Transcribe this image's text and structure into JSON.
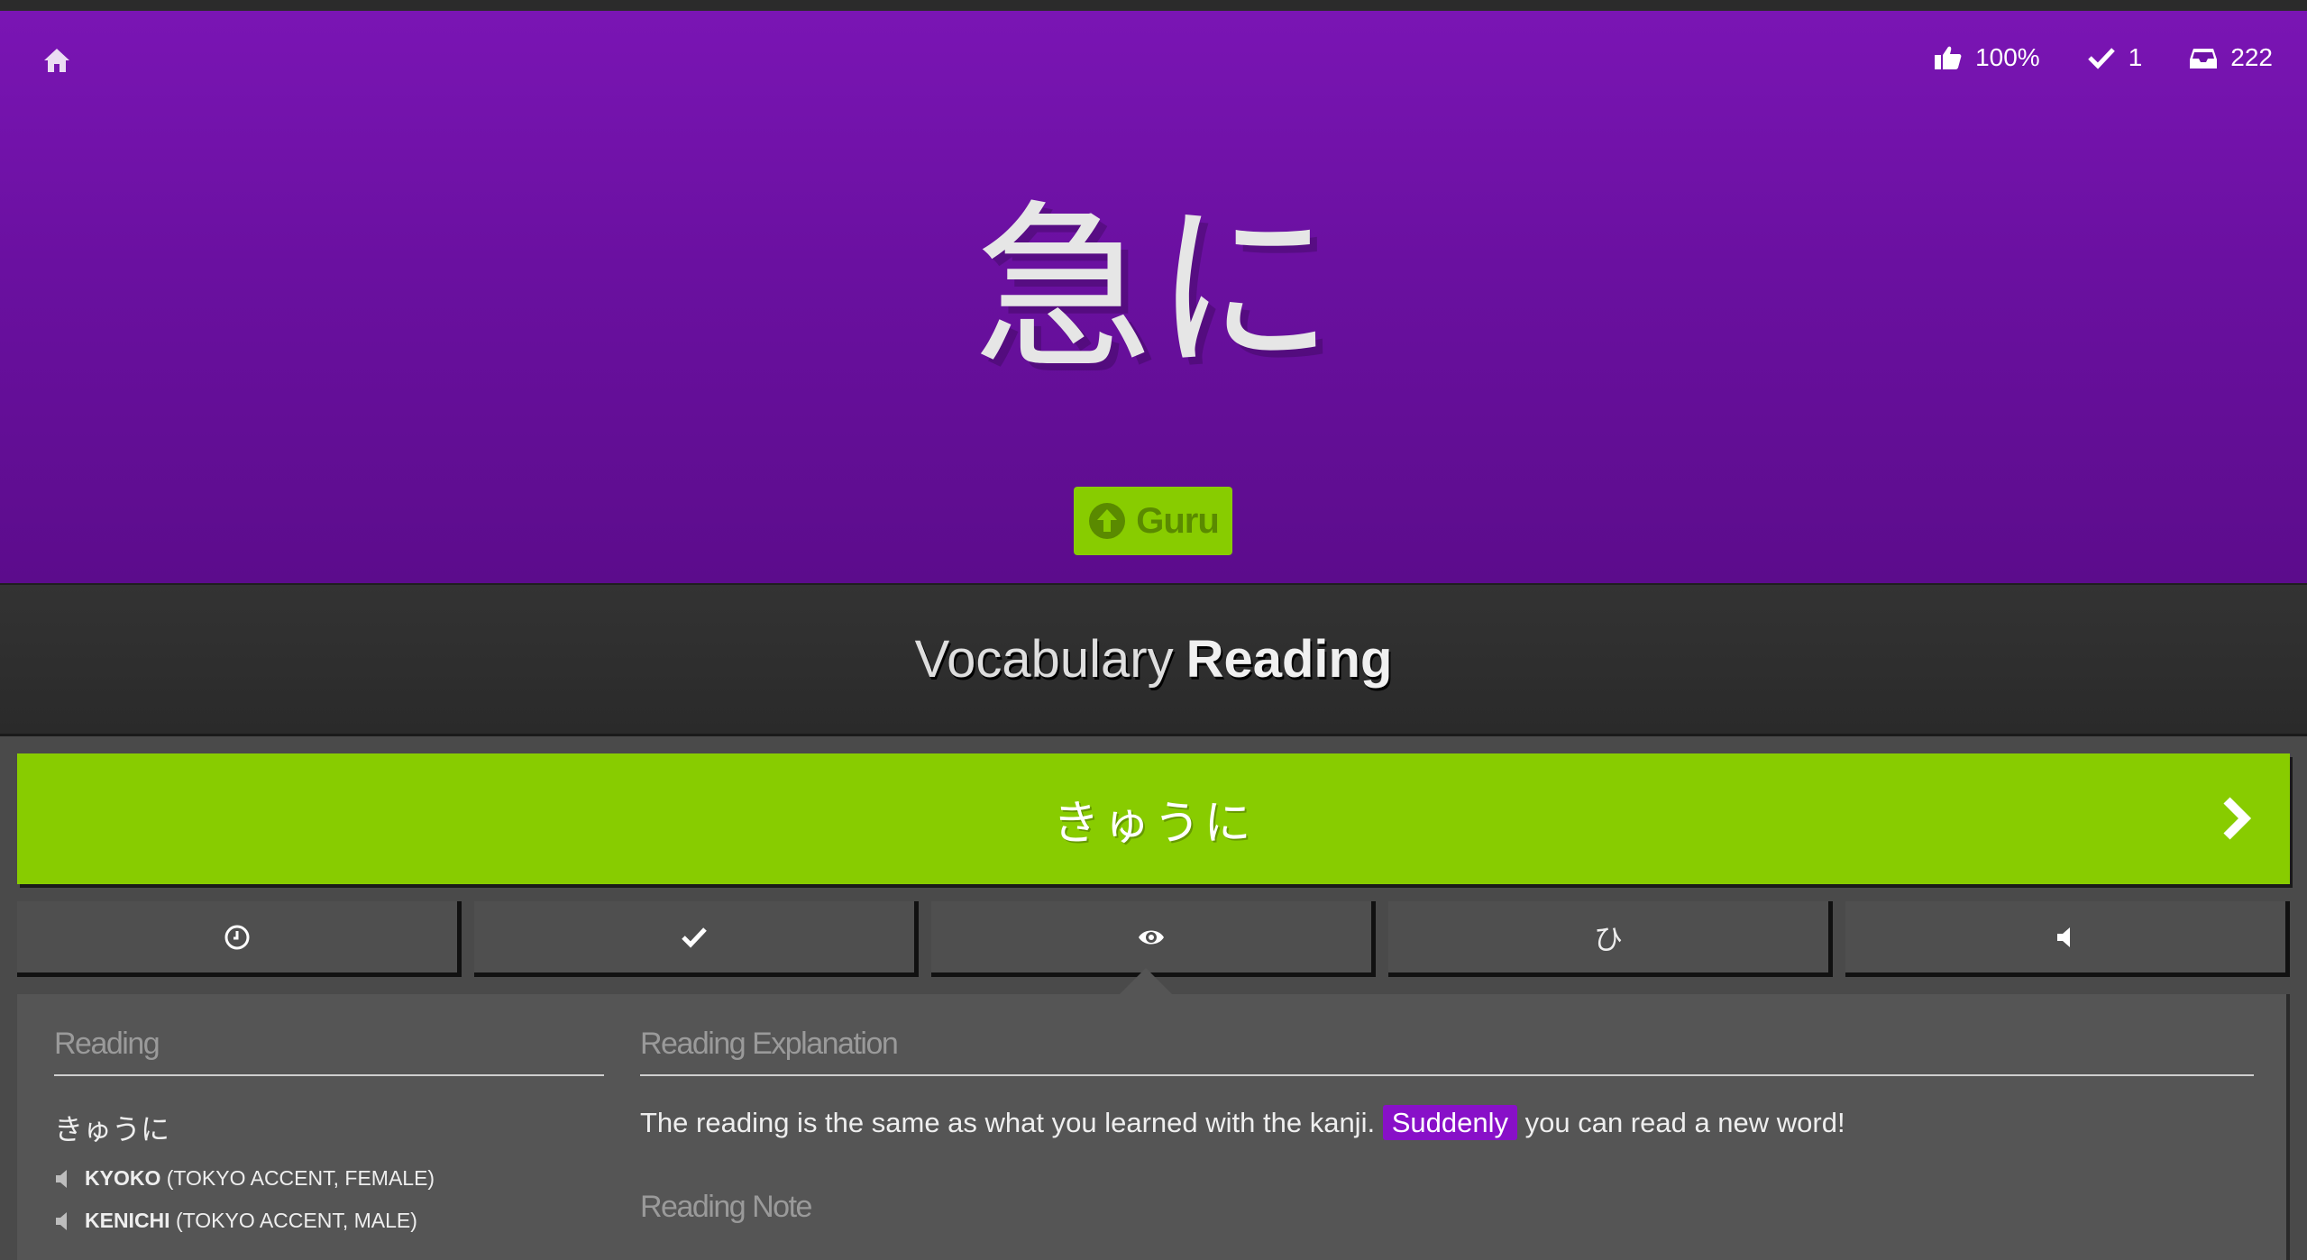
{
  "header": {
    "stats": {
      "correct_rate": "100%",
      "completed": "1",
      "remaining": "222"
    }
  },
  "item": {
    "characters": "急に",
    "srs_level": "Guru"
  },
  "quiz": {
    "type_prefix": "Vocabulary",
    "type_emphasis": "Reading",
    "answer": "きゅうに"
  },
  "tabs": [
    {
      "icon": "clock-icon"
    },
    {
      "icon": "check-icon"
    },
    {
      "icon": "eye-icon"
    },
    {
      "icon": "hiragana-icon",
      "glyph": "ひ"
    },
    {
      "icon": "speaker-icon"
    }
  ],
  "info": {
    "reading_title": "Reading",
    "reading_value": "きゅうに",
    "audio": [
      {
        "name": "KYOKO",
        "detail": "(TOKYO ACCENT, FEMALE)"
      },
      {
        "name": "KENICHI",
        "detail": "(TOKYO ACCENT, MALE)"
      }
    ],
    "explanation_title": "Reading Explanation",
    "explanation_before": "The reading is the same as what you learned with the kanji.",
    "explanation_highlight": "Suddenly",
    "explanation_after": "you can read a new word!",
    "note_title": "Reading Note"
  },
  "colors": {
    "hero": "#6a10a0",
    "correct": "#88cc00",
    "vocab": "#8810c8"
  }
}
